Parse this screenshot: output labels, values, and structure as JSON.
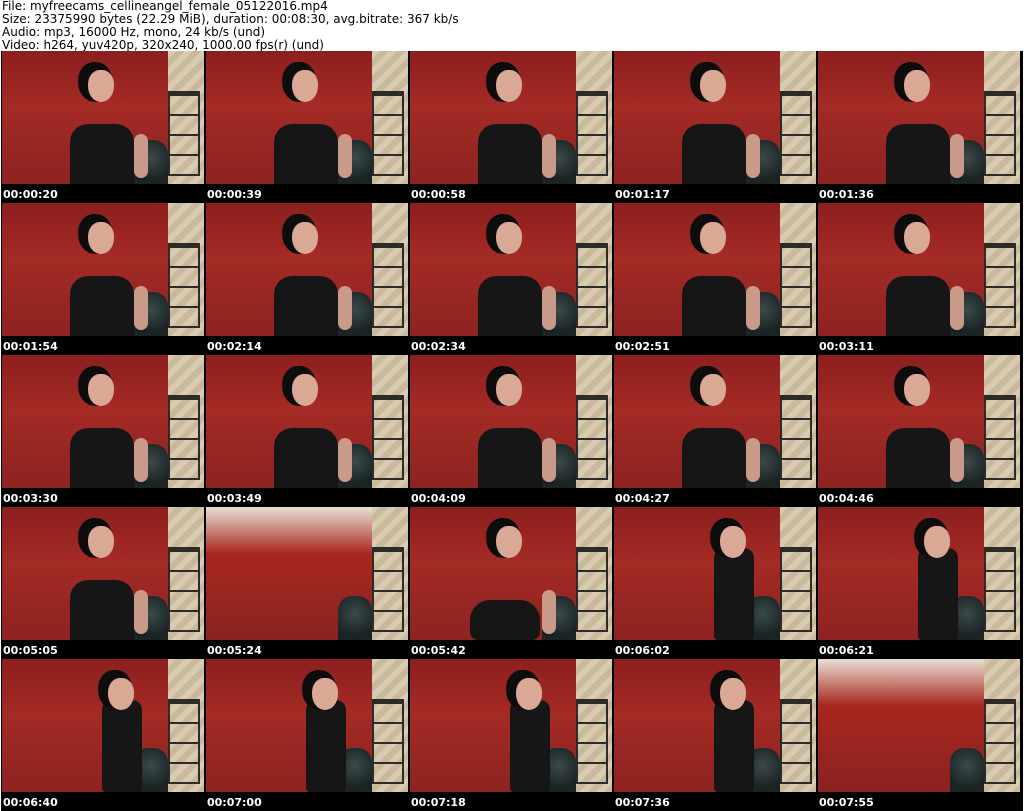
{
  "header": {
    "file_line": "File: myfreecams_cellineangel_female_05122016.mp4",
    "size_line": "Size: 23375990 bytes (22.29 MiB), duration: 00:08:30, avg.bitrate: 367 kb/s",
    "audio_line": "Audio: mp3, 16000 Hz, mono, 24 kb/s (und)",
    "video_line": "Video: h264, yuv420p, 320x240, 1000.00 fps(r) (und)"
  },
  "thumbnails": [
    {
      "time": "00:00:20"
    },
    {
      "time": "00:00:39"
    },
    {
      "time": "00:00:58"
    },
    {
      "time": "00:01:17"
    },
    {
      "time": "00:01:36"
    },
    {
      "time": "00:01:54"
    },
    {
      "time": "00:02:14"
    },
    {
      "time": "00:02:34"
    },
    {
      "time": "00:02:51"
    },
    {
      "time": "00:03:11"
    },
    {
      "time": "00:03:30"
    },
    {
      "time": "00:03:49"
    },
    {
      "time": "00:04:09"
    },
    {
      "time": "00:04:27"
    },
    {
      "time": "00:04:46"
    },
    {
      "time": "00:05:05"
    },
    {
      "time": "00:05:24"
    },
    {
      "time": "00:05:42"
    },
    {
      "time": "00:06:02"
    },
    {
      "time": "00:06:21"
    },
    {
      "time": "00:06:40"
    },
    {
      "time": "00:07:00"
    },
    {
      "time": "00:07:18"
    },
    {
      "time": "00:07:36"
    },
    {
      "time": "00:07:55"
    }
  ]
}
